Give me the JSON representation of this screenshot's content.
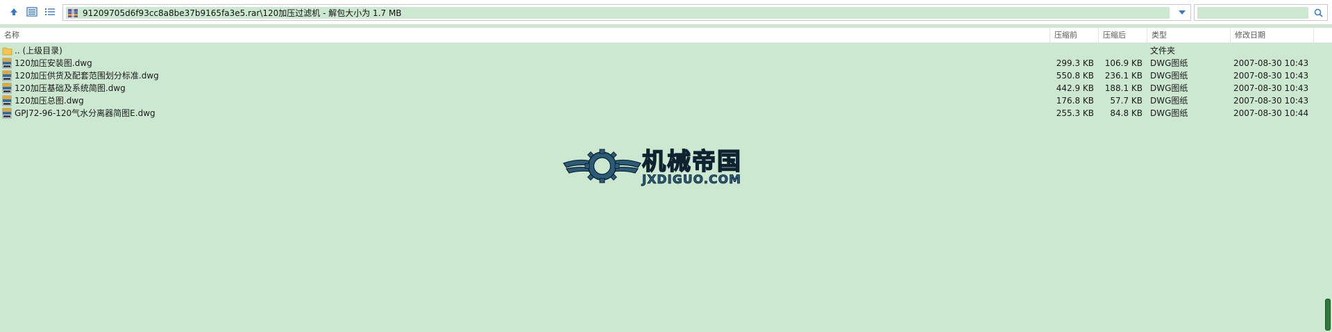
{
  "toolbar": {
    "up_icon": "arrow-up-icon",
    "view_icon": "view-details-icon",
    "list_icon": "list-icon",
    "path": "91209705d6f93cc8a8be37b9165fa3e5.rar\\120加压过滤机 - 解包大小为 1.7 MB",
    "search_placeholder": ""
  },
  "columns": {
    "name": "名称",
    "before": "压缩前",
    "after": "压缩后",
    "type": "类型",
    "date": "修改日期"
  },
  "files": [
    {
      "name": ".. (上级目录)",
      "before": "",
      "after": "",
      "type": "文件夹",
      "date": "",
      "icon": "folder-icon"
    },
    {
      "name": "120加压安装图.dwg",
      "before": "299.3 KB",
      "after": "106.9 KB",
      "type": "DWG图纸",
      "date": "2007-08-30 10:43",
      "icon": "dwg-file-icon"
    },
    {
      "name": "120加压供货及配套范围划分标准.dwg",
      "before": "550.8 KB",
      "after": "236.1 KB",
      "type": "DWG图纸",
      "date": "2007-08-30 10:43",
      "icon": "dwg-file-icon"
    },
    {
      "name": "120加压基础及系统简图.dwg",
      "before": "442.9 KB",
      "after": "188.1 KB",
      "type": "DWG图纸",
      "date": "2007-08-30 10:43",
      "icon": "dwg-file-icon"
    },
    {
      "name": "120加压总图.dwg",
      "before": "176.8 KB",
      "after": "57.7 KB",
      "type": "DWG图纸",
      "date": "2007-08-30 10:43",
      "icon": "dwg-file-icon"
    },
    {
      "name": "GPJ72-96-120气水分离器简图E.dwg",
      "before": "255.3 KB",
      "after": "84.8 KB",
      "type": "DWG图纸",
      "date": "2007-08-30 10:44",
      "icon": "dwg-file-icon"
    }
  ],
  "watermark": {
    "cn": "机械帝国",
    "en": "JXDIGUO.COM"
  },
  "colors": {
    "background": "#cde8d0",
    "logo": "#2a5c78"
  }
}
